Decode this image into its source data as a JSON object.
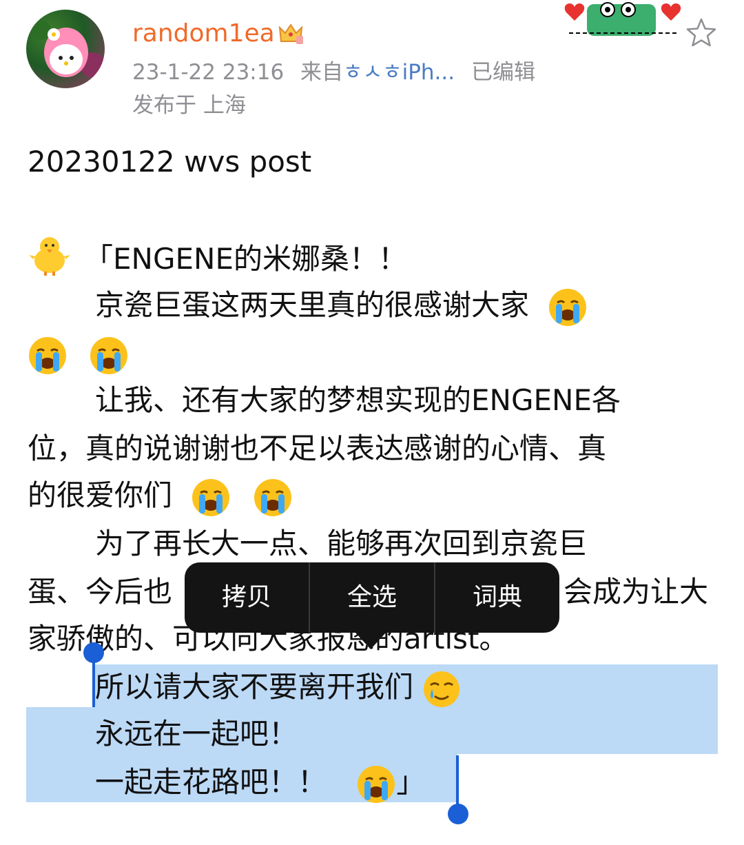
{
  "post": {
    "username": "random1ea",
    "timestamp": "23-1-22 23:16",
    "source_prefix": "来自",
    "source": "ㅎㅅㅎiPh...",
    "edited": "已编辑",
    "location": "发布于 上海"
  },
  "content": {
    "line1": "20230122 wvs post",
    "line2": "「ENGENE的米娜桑！！",
    "line3": "京瓷巨蛋这两天里真的很感谢大家",
    "line5": "让我、还有大家的梦想实现的ENGENE各",
    "line6": "位，真的说谢谢也不足以表达感谢的心情、真",
    "line7": "的很爱你们",
    "line8": "为了再长大一点、能够再次回到京瓷巨",
    "line9a": "蛋、今后也",
    "line9b": "会成为让大",
    "line10a": "家骄傲的、",
    "line10b": "可以向大家报恩的artist。",
    "line11": "所以请大家不要离开我们",
    "line12": "永远在一起吧！",
    "line13a": "一起走花路吧！！",
    "line13b": "」"
  },
  "menu": {
    "copy": "拷贝",
    "select_all": "全选",
    "dictionary": "词典"
  },
  "icons": {
    "crown": "crown-icon",
    "star": "star-icon",
    "chick": "chick-icon",
    "crying": "crying-face-icon",
    "tear_smile": "smiling-face-with-tear-icon"
  }
}
